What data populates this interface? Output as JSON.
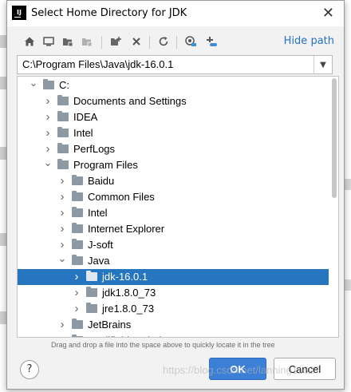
{
  "window": {
    "title": "Select Home Directory for JDK",
    "app_icon_text": "IJ"
  },
  "toolbar": {
    "buttons": [
      "home-icon",
      "desktop-icon",
      "project-folder-icon",
      "module-folder-icon",
      "new-folder-icon",
      "delete-icon",
      "refresh-icon",
      "show-hidden-icon",
      "drive-icon"
    ],
    "hide_path_label": "Hide path"
  },
  "path": {
    "value": "C:\\Program Files\\Java\\jdk-16.0.1"
  },
  "tree": {
    "items": [
      {
        "label": "C:",
        "level": 0,
        "expanded": true,
        "selected": false
      },
      {
        "label": "Documents and Settings",
        "level": 1,
        "expanded": false,
        "selected": false
      },
      {
        "label": "IDEA",
        "level": 1,
        "expanded": false,
        "selected": false
      },
      {
        "label": "Intel",
        "level": 1,
        "expanded": false,
        "selected": false
      },
      {
        "label": "PerfLogs",
        "level": 1,
        "expanded": false,
        "selected": false
      },
      {
        "label": "Program Files",
        "level": 1,
        "expanded": true,
        "selected": false
      },
      {
        "label": "Baidu",
        "level": 2,
        "expanded": false,
        "selected": false
      },
      {
        "label": "Common Files",
        "level": 2,
        "expanded": false,
        "selected": false
      },
      {
        "label": "Intel",
        "level": 2,
        "expanded": false,
        "selected": false
      },
      {
        "label": "Internet Explorer",
        "level": 2,
        "expanded": false,
        "selected": false
      },
      {
        "label": "J-soft",
        "level": 2,
        "expanded": false,
        "selected": false
      },
      {
        "label": "Java",
        "level": 2,
        "expanded": true,
        "selected": false
      },
      {
        "label": "jdk-16.0.1",
        "level": 3,
        "expanded": false,
        "selected": true
      },
      {
        "label": "jdk1.8.0_73",
        "level": 3,
        "expanded": false,
        "selected": false
      },
      {
        "label": "jre1.8.0_73",
        "level": 3,
        "expanded": false,
        "selected": false
      },
      {
        "label": "JetBrains",
        "level": 2,
        "expanded": false,
        "selected": false
      },
      {
        "label": "Modifiable Windows Apps",
        "level": 2,
        "expanded": false,
        "selected": false
      }
    ]
  },
  "hint": "Drag and drop a file into the space above to quickly locate it in the tree",
  "buttons": {
    "help": "?",
    "ok": "OK",
    "cancel": "Cancel"
  },
  "watermark": "https://blog.csdn.net/lanning11627",
  "colors": {
    "selection": "#2675bf",
    "accent": "#3c7fd6",
    "link": "#2470c2"
  }
}
